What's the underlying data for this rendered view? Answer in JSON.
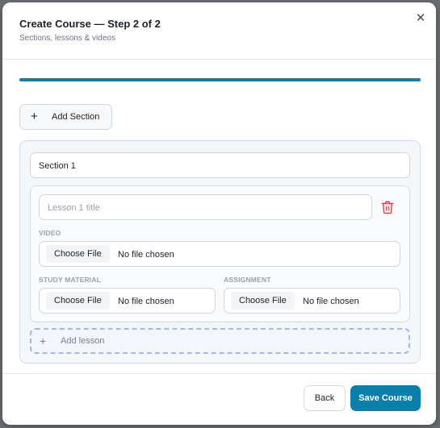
{
  "header": {
    "title": "Create Course — Step 2 of 2",
    "subtitle": "Sections, lessons & videos",
    "close_glyph": "✕"
  },
  "progress": {
    "value": 1.0,
    "color": "#0b7fab"
  },
  "add_section": {
    "icon": "plus-icon",
    "label": "Add Section"
  },
  "section": {
    "name_value": "Section 1",
    "lesson": {
      "title_placeholder": "Lesson 1 title",
      "delete_icon": "trash-icon",
      "delete_color": "#e0474c",
      "video": {
        "label": "VIDEO",
        "button": "Choose File",
        "status": "No file chosen"
      },
      "study_material": {
        "label": "STUDY MATERIAL",
        "button": "Choose File",
        "status": "No file chosen"
      },
      "assignment": {
        "label": "ASSIGNMENT",
        "button": "Choose File",
        "status": "No file chosen"
      }
    },
    "add_lesson": {
      "icon": "plus-icon",
      "label": "Add lesson"
    }
  },
  "footer": {
    "back_label": "Back",
    "save_label": "Save Course",
    "save_color": "#0b7fab"
  }
}
